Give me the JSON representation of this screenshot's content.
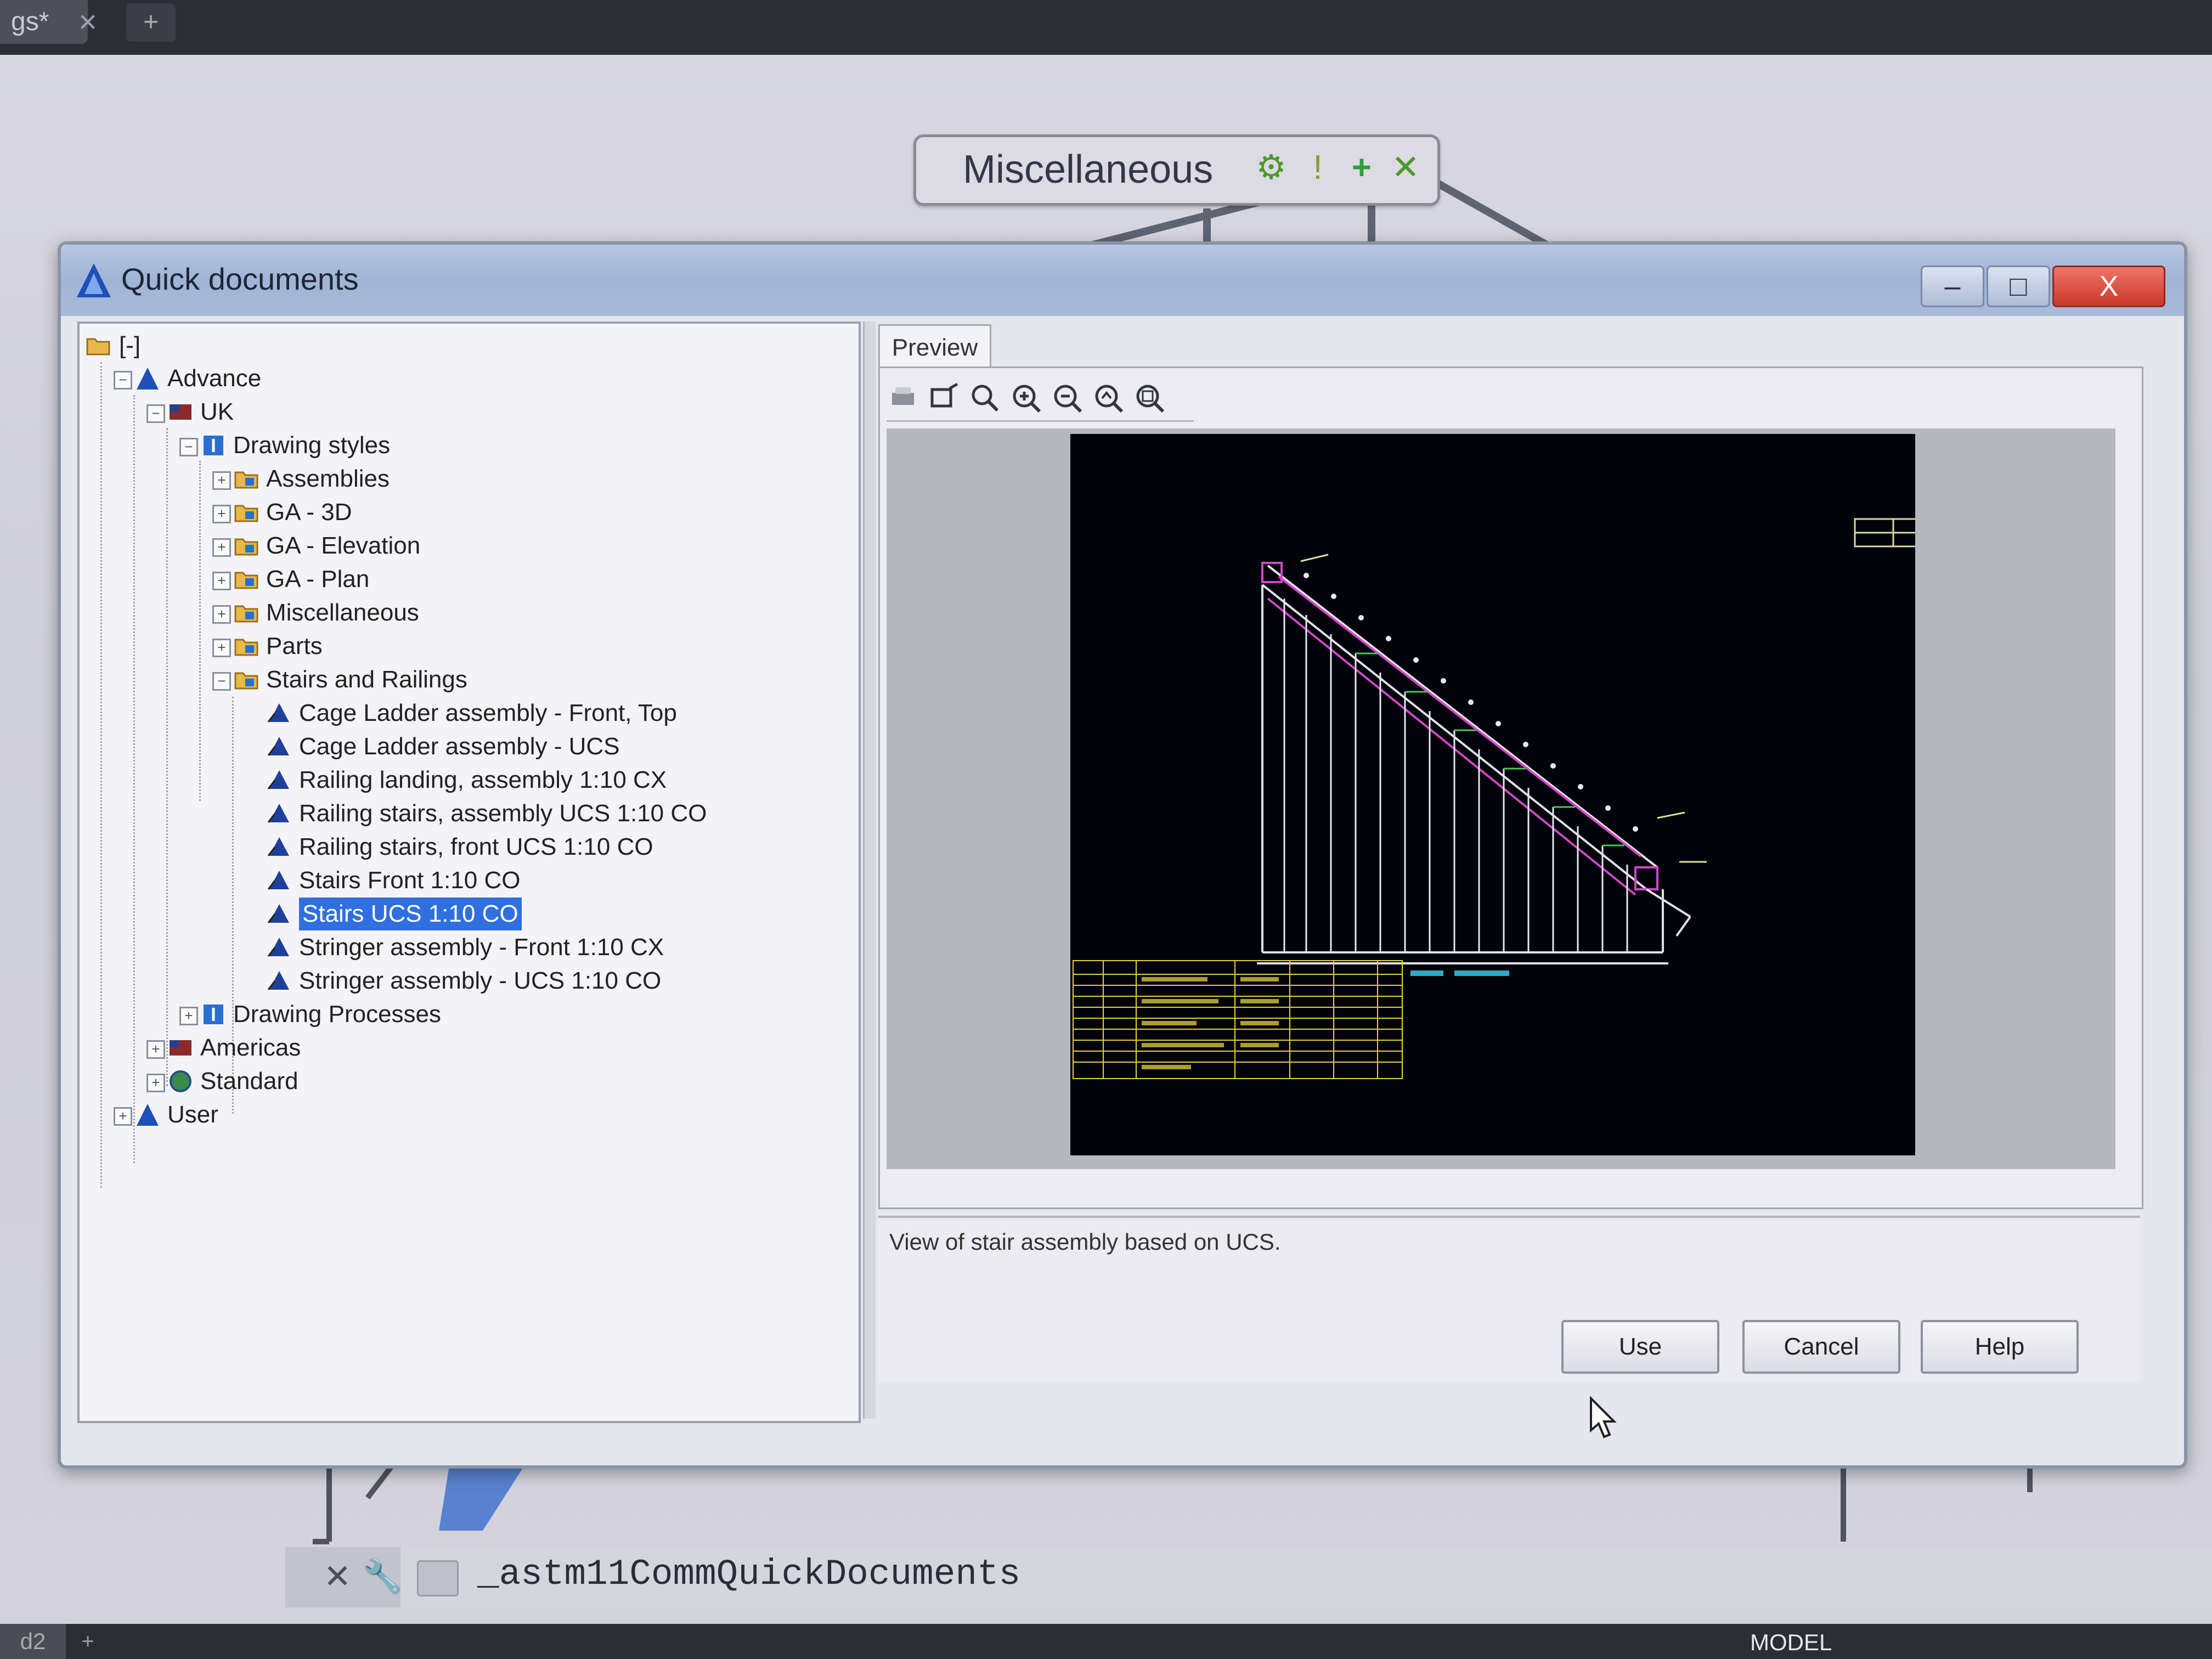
{
  "tabs": {
    "active_doc": "gs*",
    "close": "✕",
    "new_tab": "+"
  },
  "canvas_widget": {
    "label": "Miscellaneous"
  },
  "dialog": {
    "title": "Quick documents",
    "window_buttons": {
      "minimize": "–",
      "maximize": "□",
      "close": "X"
    },
    "tree": {
      "root": "[-]",
      "items": [
        {
          "label": "Advance",
          "level": 1,
          "expanded": true
        },
        {
          "label": "UK",
          "level": 2,
          "expanded": true
        },
        {
          "label": "Drawing styles",
          "level": 3,
          "expanded": true
        },
        {
          "label": "Assemblies",
          "level": 4,
          "expanded": false
        },
        {
          "label": "GA - 3D",
          "level": 4,
          "expanded": false
        },
        {
          "label": "GA - Elevation",
          "level": 4,
          "expanded": false
        },
        {
          "label": "GA - Plan",
          "level": 4,
          "expanded": false
        },
        {
          "label": "Miscellaneous",
          "level": 4,
          "expanded": false
        },
        {
          "label": "Parts",
          "level": 4,
          "expanded": false
        },
        {
          "label": "Stairs and Railings",
          "level": 4,
          "expanded": true
        },
        {
          "label": "Cage Ladder assembly - Front, Top",
          "level": 5
        },
        {
          "label": "Cage Ladder assembly - UCS",
          "level": 5
        },
        {
          "label": "Railing landing, assembly 1:10 CX",
          "level": 5
        },
        {
          "label": "Railing stairs, assembly UCS 1:10 CO",
          "level": 5
        },
        {
          "label": "Railing stairs, front UCS 1:10 CO",
          "level": 5
        },
        {
          "label": "Stairs Front 1:10 CO",
          "level": 5
        },
        {
          "label": "Stairs UCS 1:10 CO",
          "level": 5,
          "selected": true
        },
        {
          "label": "Stringer assembly - Front 1:10 CX",
          "level": 5
        },
        {
          "label": "Stringer assembly - UCS 1:10 CO",
          "level": 5
        },
        {
          "label": "Drawing Processes",
          "level": 3,
          "expanded": false
        },
        {
          "label": "Americas",
          "level": 2,
          "expanded": false
        },
        {
          "label": "Standard",
          "level": 2,
          "expanded": false
        },
        {
          "label": "User",
          "level": 1,
          "expanded": false
        }
      ]
    },
    "preview": {
      "tab_label": "Preview",
      "toolbar_icons": [
        "print-icon",
        "zoom-window-icon",
        "zoom-realtime-icon",
        "zoom-in-icon",
        "zoom-out-icon",
        "zoom-previous-icon",
        "zoom-extents-icon"
      ],
      "description": "View of stair assembly based on UCS."
    },
    "buttons": {
      "use": "Use",
      "cancel": "Cancel",
      "help": "Help"
    }
  },
  "command_line": {
    "text": "_astm11CommQuickDocuments"
  },
  "statusbar": {
    "layout_tab": "d2",
    "model": "MODEL",
    "plus": "+"
  },
  "colors": {
    "selection": "#2f6fe0",
    "title_bar": "#a9bbd9",
    "close_button": "#c8382a",
    "drawing_bg": "#02030a"
  }
}
